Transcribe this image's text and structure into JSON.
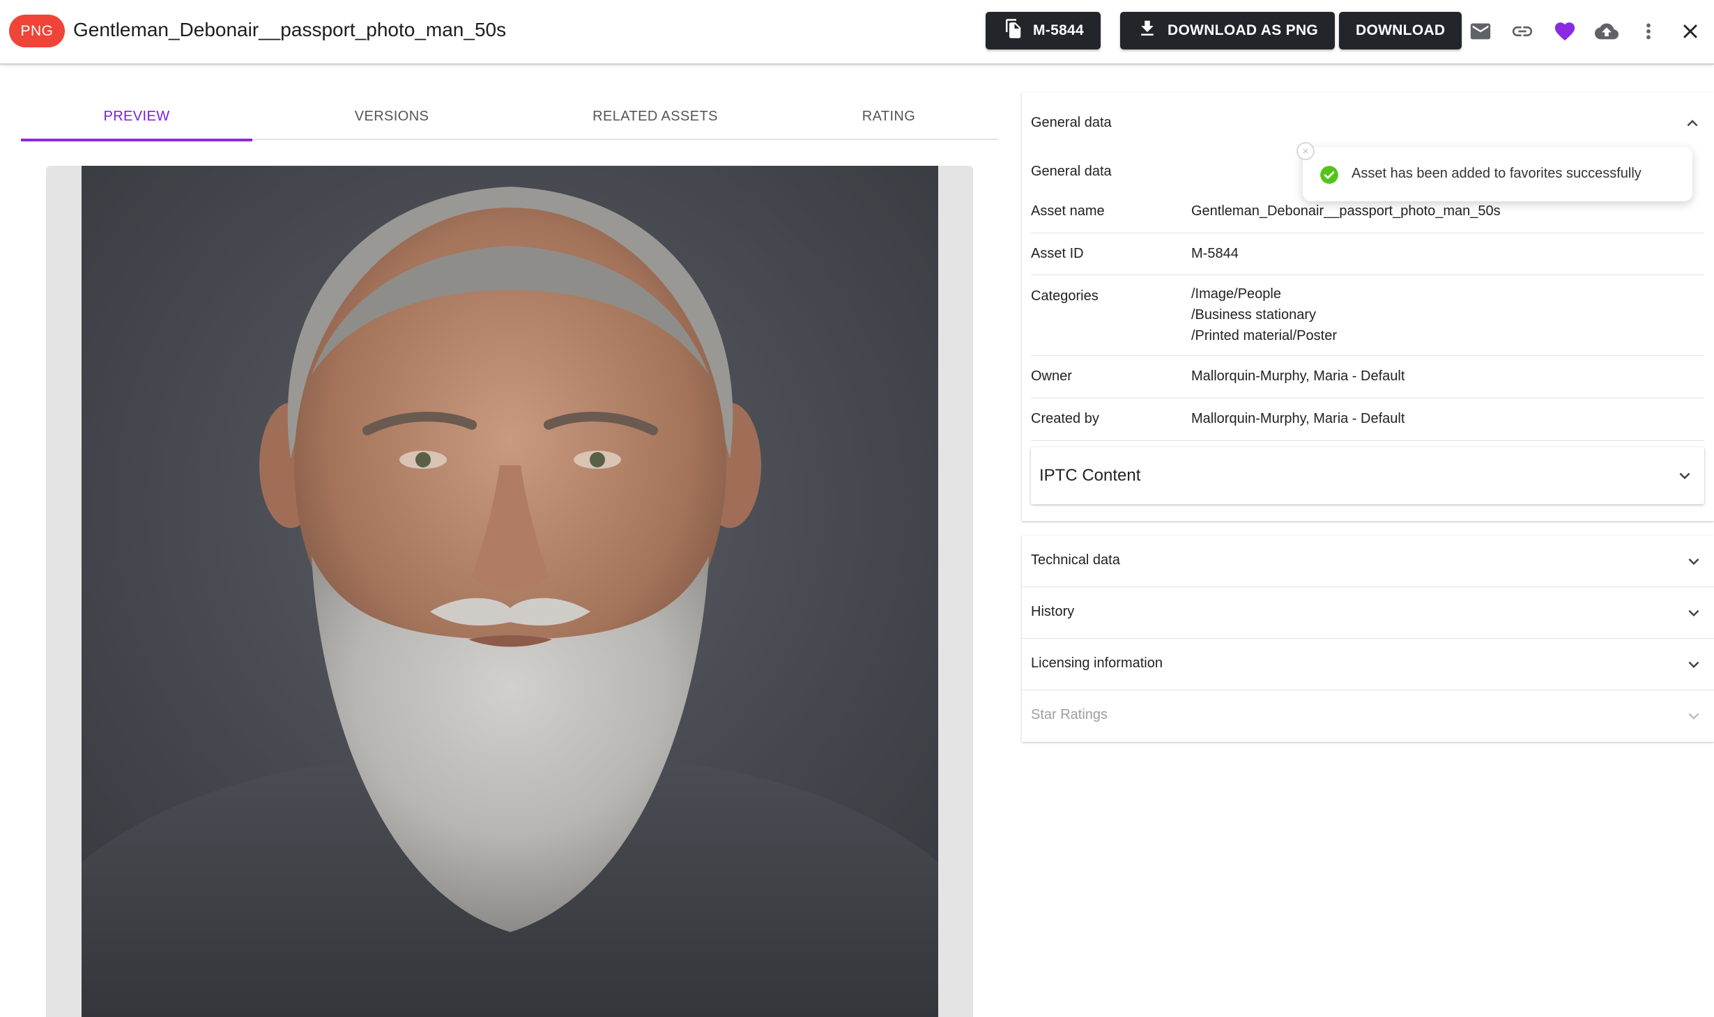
{
  "header": {
    "badge": "PNG",
    "title": "Gentleman_Debonair__passport_photo_man_50s",
    "id_button_label": "M-5844",
    "download_png_label": "DOWNLOAD AS PNG",
    "download_label": "DOWNLOAD",
    "icons": [
      "mail-icon",
      "link-icon",
      "heart-icon",
      "cloud-upload-icon",
      "more-vert-icon",
      "close-icon"
    ],
    "favorite_color": "#8a2be2"
  },
  "tabs": [
    {
      "label": "PREVIEW",
      "active": true
    },
    {
      "label": "VERSIONS",
      "active": false
    },
    {
      "label": "RELATED ASSETS",
      "active": false
    },
    {
      "label": "RATING",
      "active": false
    }
  ],
  "panel": {
    "general_header": "General data",
    "general_subheader": "General data",
    "rows": [
      {
        "label": "Asset name",
        "value": "Gentleman_Debonair__passport_photo_man_50s"
      },
      {
        "label": "Asset ID",
        "value": "M-5844"
      },
      {
        "label": "Categories",
        "values": [
          "/Image/People",
          "/Business stationary",
          "/Printed material/Poster"
        ]
      },
      {
        "label": "Owner",
        "value": "Mallorquin-Murphy, Maria - Default"
      },
      {
        "label": "Created by",
        "value": "Mallorquin-Murphy, Maria - Default"
      }
    ],
    "iptc_label": "IPTC Content",
    "sections": [
      {
        "label": "Technical data",
        "disabled": false
      },
      {
        "label": "History",
        "disabled": false
      },
      {
        "label": "Licensing information",
        "disabled": false
      },
      {
        "label": "Star Ratings",
        "disabled": true
      }
    ]
  },
  "toast": {
    "message": "Asset has been added to favorites successfully",
    "status_color": "#4caf50"
  }
}
